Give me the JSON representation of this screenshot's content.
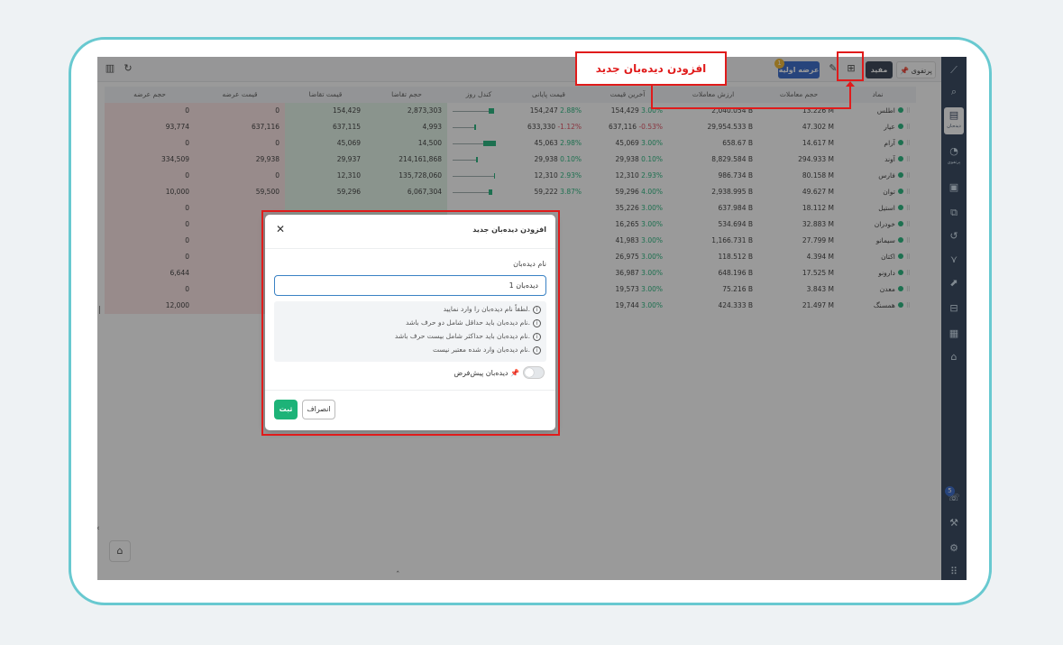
{
  "callout": {
    "text": "افزودن دیده‌بان جدید"
  },
  "topbar": {
    "watchlist_tag": "پرتفوی",
    "btn_mofid": "مفید",
    "btn_offer": "عرضه اولیه",
    "offer_badge": "1"
  },
  "sidebar": {
    "item_watchlist_label": "دیده‌بان",
    "item_portfolio_label": "پرتفوی",
    "chat_badge": "5"
  },
  "table": {
    "headers": [
      "نماد",
      "حجم معاملات",
      "ارزش معاملات",
      "آخرین قیمت",
      "قیمت پایانی",
      "کندل روز",
      "حجم تقاضا",
      "قیمت تقاضا",
      "قیمت عرضه",
      "حجم عرضه"
    ],
    "rows": [
      {
        "symbol": "اطلس",
        "vol": "13.226 M",
        "value": "2,040.054 B",
        "last": "154,429",
        "last_pct": "3.00%",
        "last_dir": "up",
        "close": "154,247",
        "close_pct": "2.88%",
        "close_dir": "up",
        "bid_vol": "2,873,303",
        "bid_price": "154,429",
        "ask_price": "0",
        "ask_vol": "0"
      },
      {
        "symbol": "عیار",
        "vol": "47.302 M",
        "value": "29,954.533 B",
        "last": "637,116",
        "last_pct": "-0.53%",
        "last_dir": "down",
        "close": "633,330",
        "close_pct": "-1.12%",
        "close_dir": "down",
        "bid_vol": "4,993",
        "bid_price": "637,115",
        "ask_price": "637,116",
        "ask_vol": "93,774"
      },
      {
        "symbol": "آرام",
        "vol": "14.617 M",
        "value": "658.67 B",
        "last": "45,069",
        "last_pct": "3.00%",
        "last_dir": "up",
        "close": "45,063",
        "close_pct": "2.98%",
        "close_dir": "up",
        "bid_vol": "14,500",
        "bid_price": "45,069",
        "ask_price": "0",
        "ask_vol": "0"
      },
      {
        "symbol": "آوند",
        "vol": "294.933 M",
        "value": "8,829.584 B",
        "last": "29,938",
        "last_pct": "0.10%",
        "last_dir": "up",
        "close": "29,938",
        "close_pct": "0.10%",
        "close_dir": "up",
        "bid_vol": "214,161,868",
        "bid_price": "29,937",
        "ask_price": "29,938",
        "ask_vol": "334,509"
      },
      {
        "symbol": "فارس",
        "vol": "80.158 M",
        "value": "986.734 B",
        "last": "12,310",
        "last_pct": "2.93%",
        "last_dir": "up",
        "close": "12,310",
        "close_pct": "2.93%",
        "close_dir": "up",
        "bid_vol": "135,728,060",
        "bid_price": "12,310",
        "ask_price": "0",
        "ask_vol": "0"
      },
      {
        "symbol": "توان",
        "vol": "49.627 M",
        "value": "2,938.995 B",
        "last": "59,296",
        "last_pct": "4.00%",
        "last_dir": "up",
        "close": "59,222",
        "close_pct": "3.87%",
        "close_dir": "up",
        "bid_vol": "6,067,304",
        "bid_price": "59,296",
        "ask_price": "59,500",
        "ask_vol": "10,000"
      },
      {
        "symbol": "استیل",
        "vol": "18.112 M",
        "value": "637.984 B",
        "last": "35,226",
        "last_pct": "3.00%",
        "last_dir": "up",
        "close": "",
        "close_pct": "",
        "close_dir": "up",
        "bid_vol": "",
        "bid_price": "",
        "ask_price": "",
        "ask_vol": "0"
      },
      {
        "symbol": "خودران",
        "vol": "32.883 M",
        "value": "534.694 B",
        "last": "16,265",
        "last_pct": "3.00%",
        "last_dir": "up",
        "close": "",
        "close_pct": "",
        "close_dir": "up",
        "bid_vol": "",
        "bid_price": "",
        "ask_price": "",
        "ask_vol": "0"
      },
      {
        "symbol": "سیمانو",
        "vol": "27.799 M",
        "value": "1,166.731 B",
        "last": "41,983",
        "last_pct": "3.00%",
        "last_dir": "up",
        "close": "",
        "close_pct": "",
        "close_dir": "up",
        "bid_vol": "",
        "bid_price": "",
        "ask_price": "",
        "ask_vol": "0"
      },
      {
        "symbol": "اکتان",
        "vol": "4.394 M",
        "value": "118.512 B",
        "last": "26,975",
        "last_pct": "3.00%",
        "last_dir": "up",
        "close": "",
        "close_pct": "",
        "close_dir": "up",
        "bid_vol": "",
        "bid_price": "",
        "ask_price": "",
        "ask_vol": "0"
      },
      {
        "symbol": "دارونو",
        "vol": "17.525 M",
        "value": "648.196 B",
        "last": "36,987",
        "last_pct": "3.00%",
        "last_dir": "up",
        "close": "",
        "close_pct": "",
        "close_dir": "up",
        "bid_vol": "",
        "bid_price": "",
        "ask_price": "",
        "ask_vol": "6,644"
      },
      {
        "symbol": "معدن",
        "vol": "3.843 M",
        "value": "75.216 B",
        "last": "19,573",
        "last_pct": "3.00%",
        "last_dir": "up",
        "close": "",
        "close_pct": "",
        "close_dir": "up",
        "bid_vol": "",
        "bid_price": "",
        "ask_price": "",
        "ask_vol": "0"
      },
      {
        "symbol": "همسنگ",
        "vol": "21.497 M",
        "value": "424.333 B",
        "last": "19,744",
        "last_pct": "3.00%",
        "last_dir": "up",
        "close": "",
        "close_pct": "",
        "close_dir": "up",
        "bid_vol": "",
        "bid_price": "",
        "ask_price": "",
        "ask_vol": "12,000"
      }
    ]
  },
  "modal": {
    "title": "افزودن دیده‌بان جدید",
    "field_label": "نام دیده‌بان",
    "input_value": "دیده‌بان 1",
    "rules": [
      "لطفاً نام دیده‌بان را وارد نمایید.",
      "نام دیده‌بان باید حداقل شامل دو حرف باشد.",
      "نام دیده‌بان باید حداکثر شامل بیست حرف باشد.",
      "نام دیده‌بان وارد شده معتبر نیست."
    ],
    "default_toggle_label": "دیده‌بان پیش‌فرض",
    "submit_label": "ثبت",
    "cancel_label": "انصراف"
  },
  "colors": {
    "up": "#1db378",
    "down": "#e0475a",
    "highlight": "#e01b1b",
    "sidebar": "#2b3d57",
    "primary": "#2f63c8"
  }
}
